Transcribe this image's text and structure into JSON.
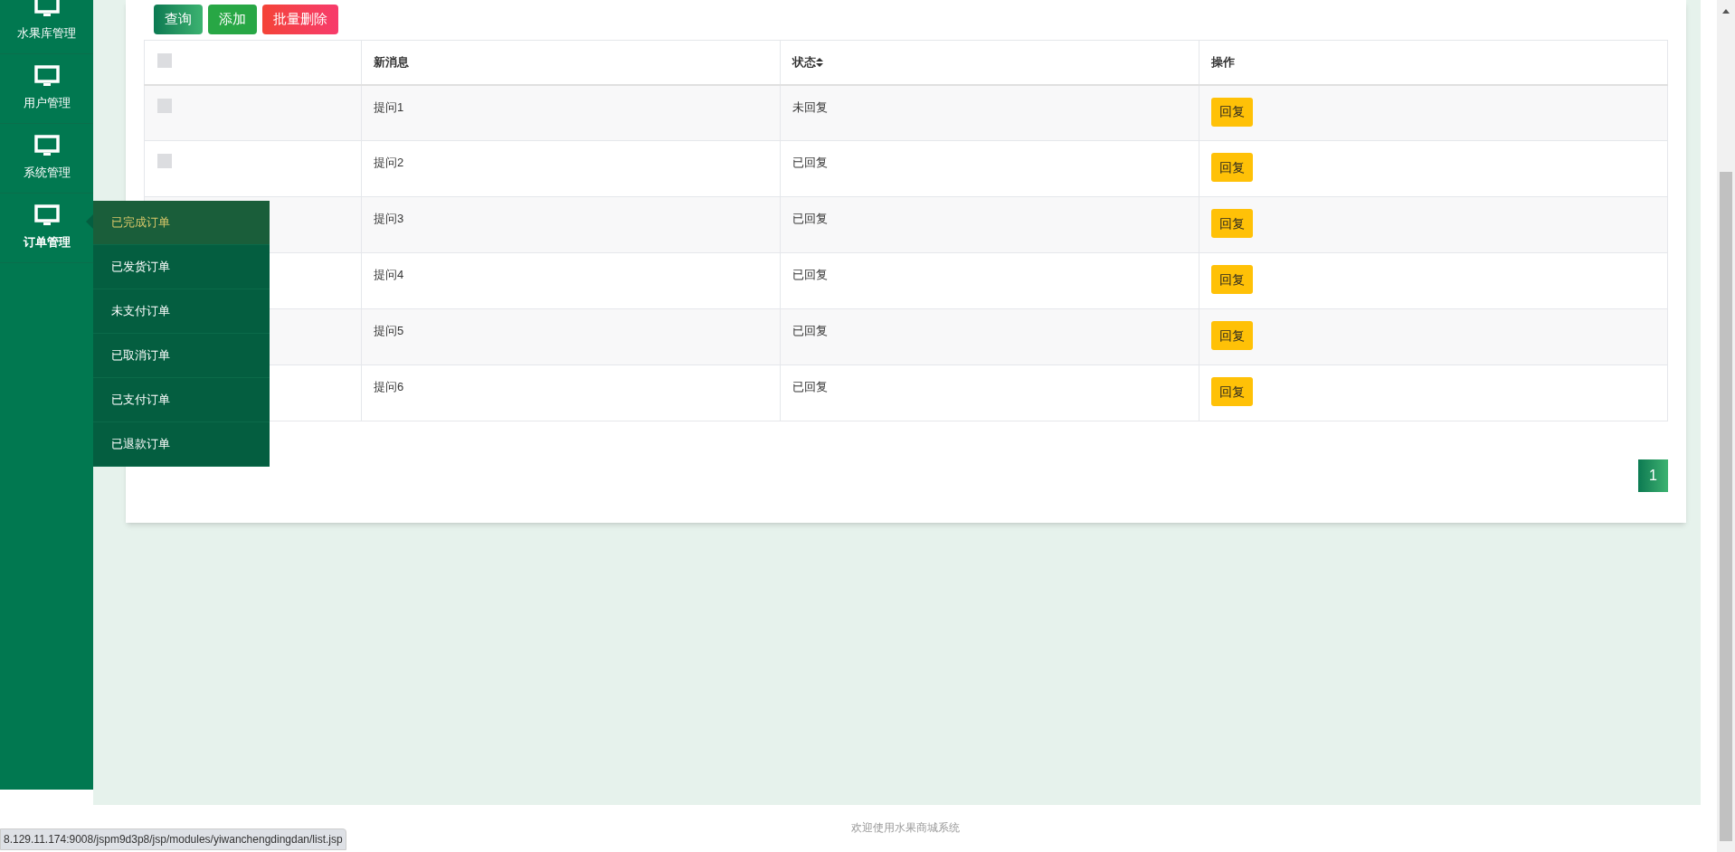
{
  "sidebar": {
    "items": [
      {
        "label": "水果库管理",
        "selected": false
      },
      {
        "label": "用户管理",
        "selected": false
      },
      {
        "label": "系统管理",
        "selected": false
      },
      {
        "label": "订单管理",
        "selected": true
      }
    ]
  },
  "submenu": {
    "items": [
      {
        "label": "已完成订单",
        "selected": true
      },
      {
        "label": "已发货订单",
        "selected": false
      },
      {
        "label": "未支付订单",
        "selected": false
      },
      {
        "label": "已取消订单",
        "selected": false
      },
      {
        "label": "已支付订单",
        "selected": false
      },
      {
        "label": "已退款订单",
        "selected": false
      }
    ]
  },
  "toolbar": [
    {
      "label": "查询",
      "kind": "search"
    },
    {
      "label": "添加",
      "kind": "add"
    },
    {
      "label": "批量删除",
      "kind": "delete"
    }
  ],
  "table": {
    "header_checkbox": {
      "checked": false
    },
    "columns": [
      "新消息",
      "状态",
      "操作"
    ],
    "rows": [
      {
        "checkbox": {
          "checked": false
        },
        "message": "提问1",
        "status": "未回复",
        "action": "回复"
      },
      {
        "checkbox": {
          "checked": false
        },
        "message": "提问2",
        "status": "已回复",
        "action": "回复"
      },
      {
        "message": "提问3",
        "status": "已回复",
        "action": "回复"
      },
      {
        "message": "提问4",
        "status": "已回复",
        "action": "回复"
      },
      {
        "message": "提问5",
        "status": "已回复",
        "action": "回复"
      },
      {
        "message": "提问6",
        "status": "已回复",
        "action": "回复"
      }
    ]
  },
  "pagination": [
    {
      "label": "1",
      "selected": true
    }
  ],
  "footer": "欢迎使用水果商城系统",
  "status_url": "8.129.11.174:9008/jspm9d3p8/jsp/modules/yiwanchengdingdan/list.jsp"
}
